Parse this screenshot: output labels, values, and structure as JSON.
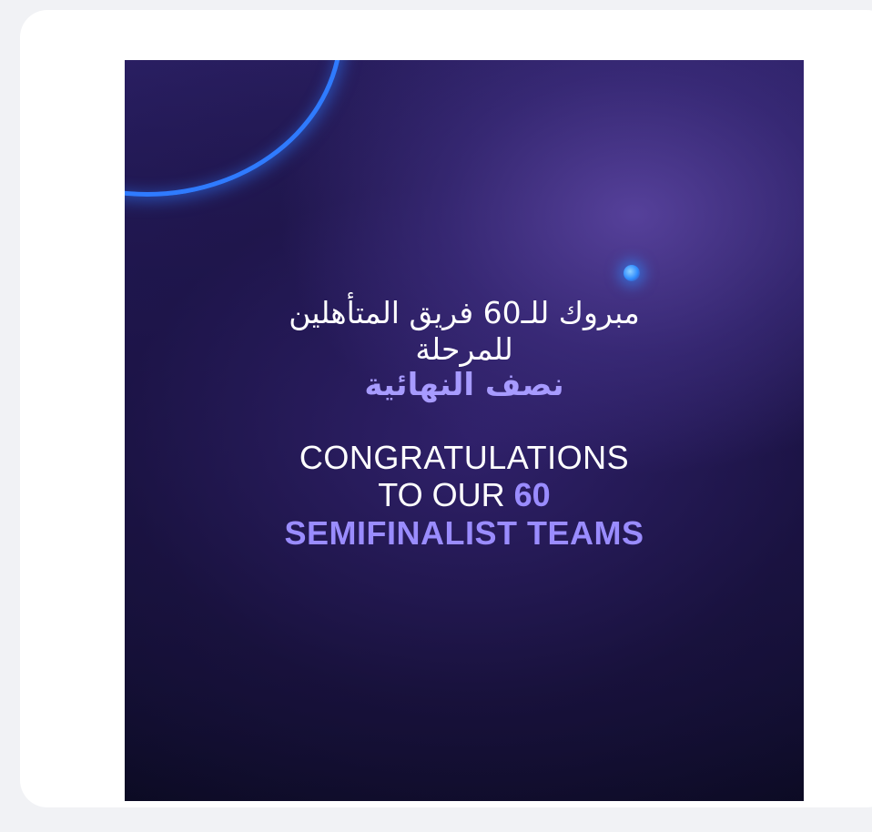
{
  "post": {
    "arabic": {
      "line1": "مبروك للـ60 فريق المتأهلين",
      "line2": "للمرحلة",
      "line3": "نصف النهائية"
    },
    "english": {
      "line1": "CONGRATULATIONS",
      "line2_prefix": "TO OUR ",
      "line2_number": "60",
      "line3": "SEMIFINALIST TEAMS"
    }
  },
  "colors": {
    "page_background": "#f1f2f5",
    "card_background": "#ffffff",
    "accent_purple": "#9a8cff",
    "arc_blue": "#2f7bff"
  }
}
